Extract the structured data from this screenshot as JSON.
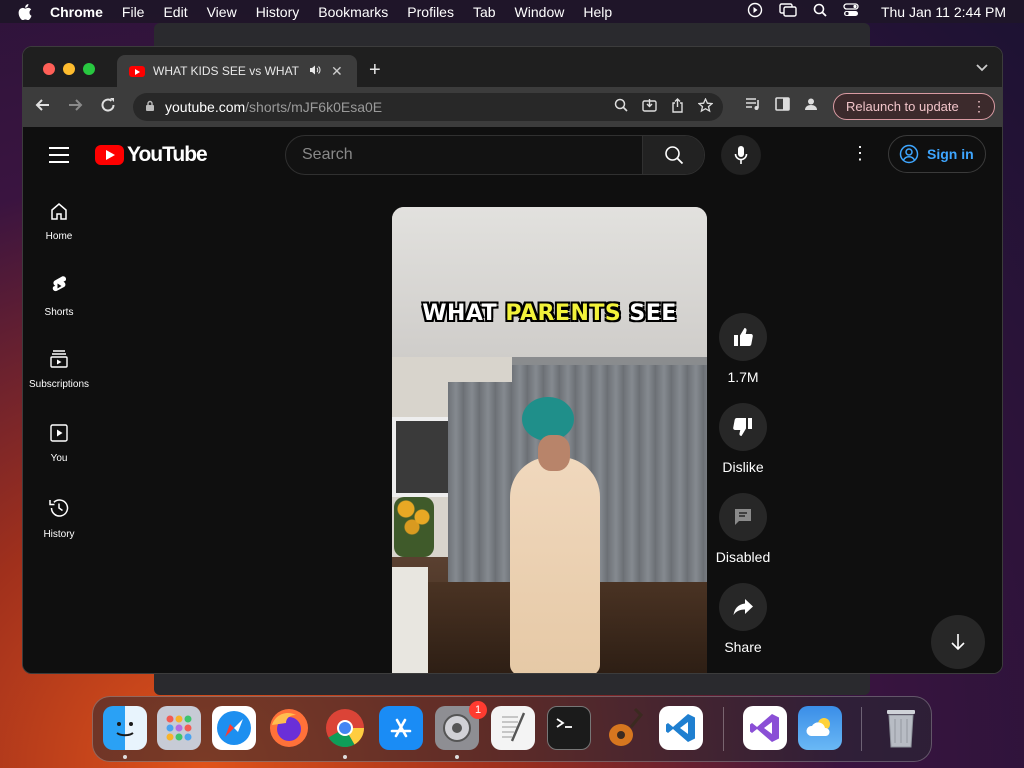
{
  "menubar": {
    "app_name": "Chrome",
    "menus": [
      "File",
      "Edit",
      "View",
      "History",
      "Bookmarks",
      "Profiles",
      "Tab",
      "Window",
      "Help"
    ],
    "clock": "Thu Jan 11  2:44 PM"
  },
  "browser": {
    "tab_title": "WHAT KIDS SEE vs WHAT PARENTS SEE",
    "url_host": "youtube.com",
    "url_path": "/shorts/mJF6k0Esa0E",
    "relaunch_label": "Relaunch to update"
  },
  "youtube": {
    "logo_text": "YouTube",
    "search_placeholder": "Search",
    "sign_in_label": "Sign in",
    "sidebar": [
      {
        "label": "Home",
        "icon": "home-icon"
      },
      {
        "label": "Shorts",
        "icon": "shorts-icon"
      },
      {
        "label": "Subscriptions",
        "icon": "subscriptions-icon"
      },
      {
        "label": "You",
        "icon": "you-icon"
      },
      {
        "label": "History",
        "icon": "history-icon"
      }
    ],
    "video_caption_white": "WHAT ",
    "video_caption_highlight": "PARENTS",
    "video_caption_end": " SEE",
    "actions": {
      "like_count": "1.7M",
      "dislike_label": "Dislike",
      "comments_label": "Disabled",
      "share_label": "Share"
    }
  },
  "dock": {
    "apps": [
      "finder-icon",
      "launchpad-icon",
      "safari-icon",
      "firefox-icon",
      "chrome-icon",
      "app-store-icon",
      "system-settings-icon",
      "textedit-icon",
      "terminal-icon",
      "garageband-icon",
      "vscode-icon",
      "visual-studio-icon",
      "weather-icon",
      "trash-icon"
    ],
    "settings_badge": "1"
  },
  "colors": {
    "youtube_red": "#ff0000",
    "signin_blue": "#3ea6ff",
    "caption_highlight": "#f2f23a"
  }
}
